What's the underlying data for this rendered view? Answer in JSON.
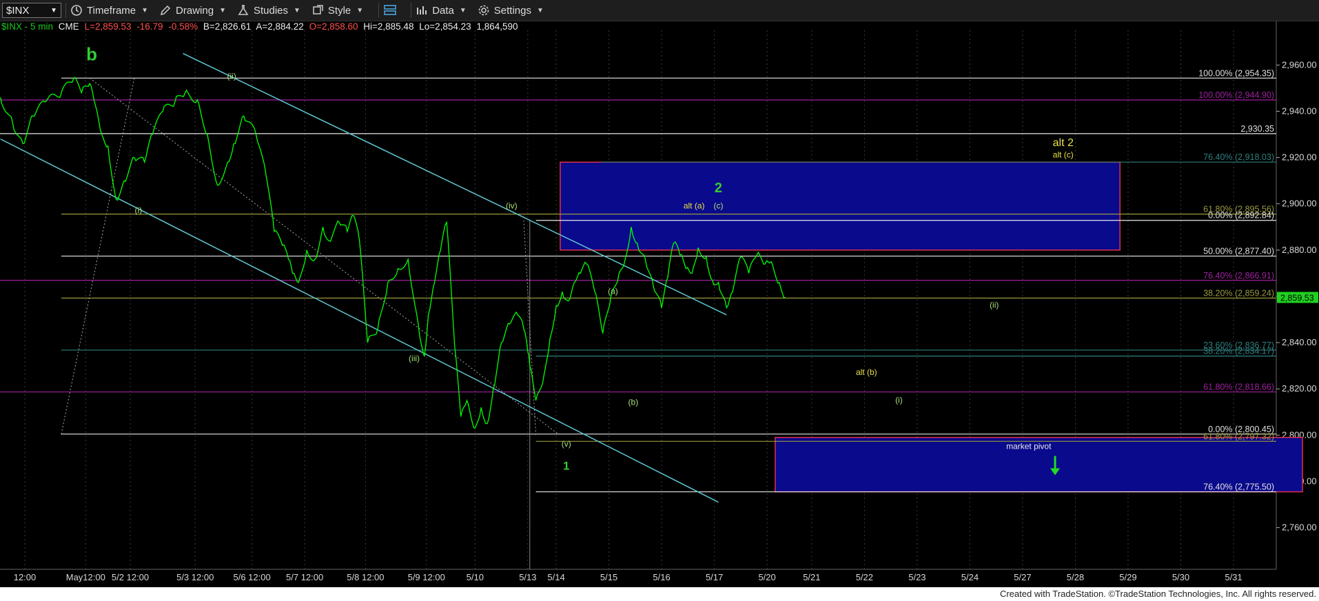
{
  "toolbar": {
    "symbol": "$INX",
    "timeframe": "Timeframe",
    "drawing": "Drawing",
    "studies": "Studies",
    "style": "Style",
    "data": "Data",
    "settings": "Settings"
  },
  "info": {
    "name": "$INX - 5 min",
    "exchange": "CME",
    "last": "L=2,859.53",
    "change": "-16.79",
    "pct": "-0.58%",
    "bid": "B=2,826.61",
    "ask": "A=2,884.22",
    "open": "O=2,858.60",
    "high": "Hi=2,885.48",
    "low": "Lo=2,854.23",
    "volume": "1,864,590"
  },
  "footer": "Created with TradeStation. ©TradeStation Technologies, Inc. All rights reserved.",
  "colors": {
    "price": "#00ff00",
    "channel": "#5fc7d4",
    "box": "#0a0a8c",
    "boxBorder": "#e0304a",
    "yellowLabel": "#e8e04a",
    "greenLabel": "#33cc33",
    "lightGreenLabel": "#a8e07a",
    "purpleLine": "#a020a0",
    "white": "#e8e8e8",
    "olive": "#9a9a40",
    "teal": "#2f7f7f"
  },
  "chart_data": {
    "type": "line",
    "title": "",
    "xlabel": "",
    "ylabel": "",
    "ylim": [
      2742,
      2975
    ],
    "yticks": [
      {
        "v": 2960,
        "label": "2,960.00"
      },
      {
        "v": 2940,
        "label": "2,940.00"
      },
      {
        "v": 2920,
        "label": "2,920.00"
      },
      {
        "v": 2900,
        "label": "2,900.00"
      },
      {
        "v": 2880,
        "label": "2,880.00"
      },
      {
        "v": 2860,
        "label": "2,860.00"
      },
      {
        "v": 2840,
        "label": "2,840.00"
      },
      {
        "v": 2820,
        "label": "2,820.00"
      },
      {
        "v": 2800,
        "label": "2,800.00"
      },
      {
        "v": 2780,
        "label": "2,780.00"
      },
      {
        "v": 2760,
        "label": "2,760.00"
      }
    ],
    "xticks": [
      "12:00",
      "May12:00",
      "5/2 12:00",
      "5/3 12:00",
      "5/6 12:00",
      "5/7 12:00",
      "5/8 12:00",
      "5/9 12:00",
      "5/10",
      "5/13",
      "5/14",
      "5/15",
      "5/16",
      "5/17",
      "5/20",
      "5/21",
      "5/22",
      "5/23",
      "5/24",
      "5/27",
      "5/28",
      "5/29",
      "5/30",
      "5/31"
    ],
    "xtick_slots": [
      0.6,
      2.1,
      3.2,
      4.8,
      6.2,
      7.5,
      9.0,
      10.5,
      11.7,
      13.0,
      13.7,
      15.0,
      16.3,
      17.6,
      18.9,
      20.0,
      21.3,
      22.6,
      23.9,
      25.2,
      26.5,
      27.8,
      29.1,
      30.4
    ],
    "last_price": {
      "value": 2859.53,
      "label": "2,859.53"
    },
    "series": [
      {
        "x": [
          0.0,
          0.3,
          0.55,
          0.8,
          1.1,
          1.5,
          1.8,
          2.0,
          2.2,
          2.35,
          2.5,
          2.65,
          2.85,
          3.05,
          3.3,
          3.55,
          3.75,
          4.0,
          4.3,
          4.55,
          4.85,
          5.1,
          5.35,
          5.6,
          5.75,
          6.0,
          6.3,
          6.55,
          6.75,
          6.95,
          7.1,
          7.2,
          7.35,
          7.55,
          7.75,
          7.95,
          8.1,
          8.35,
          8.55,
          8.7,
          8.85,
          9.05,
          9.3,
          9.55,
          9.8,
          10.05,
          10.3,
          10.45,
          10.55,
          10.7,
          10.85,
          11.0,
          11.2,
          11.35,
          11.5,
          11.7,
          11.85,
          12.0,
          12.15,
          12.35,
          12.55,
          12.75,
          12.9,
          13.0,
          13.05,
          13.2,
          13.4,
          13.55,
          13.7,
          13.85,
          14.0,
          14.15,
          14.3,
          14.45,
          14.65,
          14.85,
          15.05,
          15.25,
          15.4,
          15.55,
          15.7,
          15.9,
          16.1,
          16.3,
          16.45,
          16.6,
          16.75,
          16.9,
          17.05,
          17.2,
          17.4,
          17.55,
          17.7,
          17.9,
          18.05,
          18.25,
          18.45,
          18.65,
          18.85,
          19.0,
          19.2,
          19.35
        ],
        "values": [
          2946,
          2935,
          2926,
          2938,
          2944,
          2948,
          2954,
          2948,
          2952,
          2942,
          2930,
          2925,
          2902,
          2910,
          2920,
          2918,
          2930,
          2940,
          2944,
          2948,
          2945,
          2930,
          2908,
          2918,
          2926,
          2938,
          2930,
          2912,
          2888,
          2882,
          2876,
          2870,
          2866,
          2880,
          2876,
          2890,
          2884,
          2892,
          2888,
          2895,
          2884,
          2840,
          2846,
          2866,
          2872,
          2876,
          2848,
          2834,
          2852,
          2866,
          2880,
          2892,
          2838,
          2808,
          2815,
          2803,
          2812,
          2805,
          2820,
          2840,
          2848,
          2852,
          2846,
          2836,
          2830,
          2815,
          2826,
          2842,
          2856,
          2862,
          2858,
          2866,
          2870,
          2874,
          2862,
          2844,
          2860,
          2870,
          2876,
          2890,
          2883,
          2876,
          2864,
          2855,
          2868,
          2883,
          2878,
          2872,
          2870,
          2881,
          2877,
          2867,
          2866,
          2855,
          2862,
          2877,
          2870,
          2878,
          2874,
          2875,
          2866,
          2859.53
        ]
      }
    ],
    "fib_lines": [
      {
        "v": 2954.35,
        "label": "100.00% (2,954.35)",
        "color": "white",
        "from": 1.5
      },
      {
        "v": 2944.9,
        "label": "100.00% (2,944.90)",
        "color": "purpleLine",
        "from": 0
      },
      {
        "v": 2930.35,
        "label": "2,930.35",
        "color": "white",
        "from": 0
      },
      {
        "v": 2918.03,
        "label": "76.40% (2,918.03)",
        "color": "teal",
        "from": 14.8
      },
      {
        "v": 2895.56,
        "label": "61.80% (2,895.56)",
        "color": "olive",
        "from": 1.5
      },
      {
        "v": 2892.84,
        "label": "0.00% (2,892.84)",
        "color": "white",
        "from": 13.2
      },
      {
        "v": 2877.4,
        "label": "50.00% (2,877.40)",
        "color": "white",
        "from": 1.5
      },
      {
        "v": 2866.91,
        "label": "76.40% (2,866.91)",
        "color": "purpleLine",
        "from": 0
      },
      {
        "v": 2859.24,
        "label": "38.20% (2,859.24)",
        "color": "olive",
        "from": 1.5
      },
      {
        "v": 2836.77,
        "label": "23.60% (2,836.77)",
        "color": "teal",
        "from": 1.5
      },
      {
        "v": 2834.17,
        "label": "38.20% (2,834.17)",
        "color": "teal",
        "from": 13.2
      },
      {
        "v": 2818.66,
        "label": "61.80% (2,818.66)",
        "color": "purpleLine",
        "from": 0
      },
      {
        "v": 2800.45,
        "label": "0.00% (2,800.45)",
        "color": "white",
        "from": 1.5
      },
      {
        "v": 2797.32,
        "label": "61.80% (2,797.32)",
        "color": "olive",
        "from": 13.2
      },
      {
        "v": 2775.5,
        "label": "76.40% (2,775.50)",
        "color": "white",
        "from": 13.2
      }
    ],
    "boxes": [
      {
        "x0": 13.8,
        "x1": 27.6,
        "y0": 2880,
        "y1": 2918
      },
      {
        "x0": 19.1,
        "x1": 32.1,
        "y0": 2775.5,
        "y1": 2799
      }
    ],
    "channel_lines": [
      {
        "x0": 4.5,
        "y0": 2965,
        "x1": 17.9,
        "y1": 2852
      },
      {
        "x0": 0,
        "y0": 2928,
        "x1": 17.7,
        "y1": 2771
      }
    ],
    "annotations": [
      {
        "text": "b",
        "x": 2.25,
        "v": 2962,
        "color": "greenLabel",
        "size": 26,
        "bold": true
      },
      {
        "text": "(i)",
        "x": 3.4,
        "v": 2896,
        "color": "lightGreenLabel",
        "size": 12
      },
      {
        "text": "(ii)",
        "x": 5.7,
        "v": 2954,
        "color": "lightGreenLabel",
        "size": 12
      },
      {
        "text": "(iii)",
        "x": 10.2,
        "v": 2832,
        "color": "lightGreenLabel",
        "size": 12
      },
      {
        "text": "(iv)",
        "x": 12.6,
        "v": 2898,
        "color": "lightGreenLabel",
        "size": 12
      },
      {
        "text": "(v)",
        "x": 13.95,
        "v": 2795,
        "color": "lightGreenLabel",
        "size": 12
      },
      {
        "text": "1",
        "x": 13.95,
        "v": 2785,
        "color": "greenLabel",
        "size": 17,
        "bold": true
      },
      {
        "text": "(a)",
        "x": 15.1,
        "v": 2861,
        "color": "lightGreenLabel",
        "size": 12
      },
      {
        "text": "(b)",
        "x": 15.6,
        "v": 2813,
        "color": "lightGreenLabel",
        "size": 12
      },
      {
        "text": "2",
        "x": 17.7,
        "v": 2905,
        "color": "greenLabel",
        "size": 20,
        "bold": true
      },
      {
        "text": "alt (a)",
        "x": 17.1,
        "v": 2898,
        "color": "yellowLabel",
        "size": 12
      },
      {
        "text": "(c)",
        "x": 17.7,
        "v": 2898,
        "color": "lightGreenLabel",
        "size": 12
      },
      {
        "text": "alt 2",
        "x": 26.2,
        "v": 2925,
        "color": "yellowLabel",
        "size": 16
      },
      {
        "text": "alt (c)",
        "x": 26.2,
        "v": 2920,
        "color": "yellowLabel",
        "size": 12
      },
      {
        "text": "(ii)",
        "x": 24.5,
        "v": 2855,
        "color": "lightGreenLabel",
        "size": 12
      },
      {
        "text": "alt (b)",
        "x": 21.35,
        "v": 2826,
        "color": "yellowLabel",
        "size": 12
      },
      {
        "text": "(i)",
        "x": 22.15,
        "v": 2814,
        "color": "lightGreenLabel",
        "size": 12
      },
      {
        "text": "market pivot",
        "x": 25.35,
        "v": 2794,
        "color": "white",
        "size": 12
      }
    ]
  }
}
